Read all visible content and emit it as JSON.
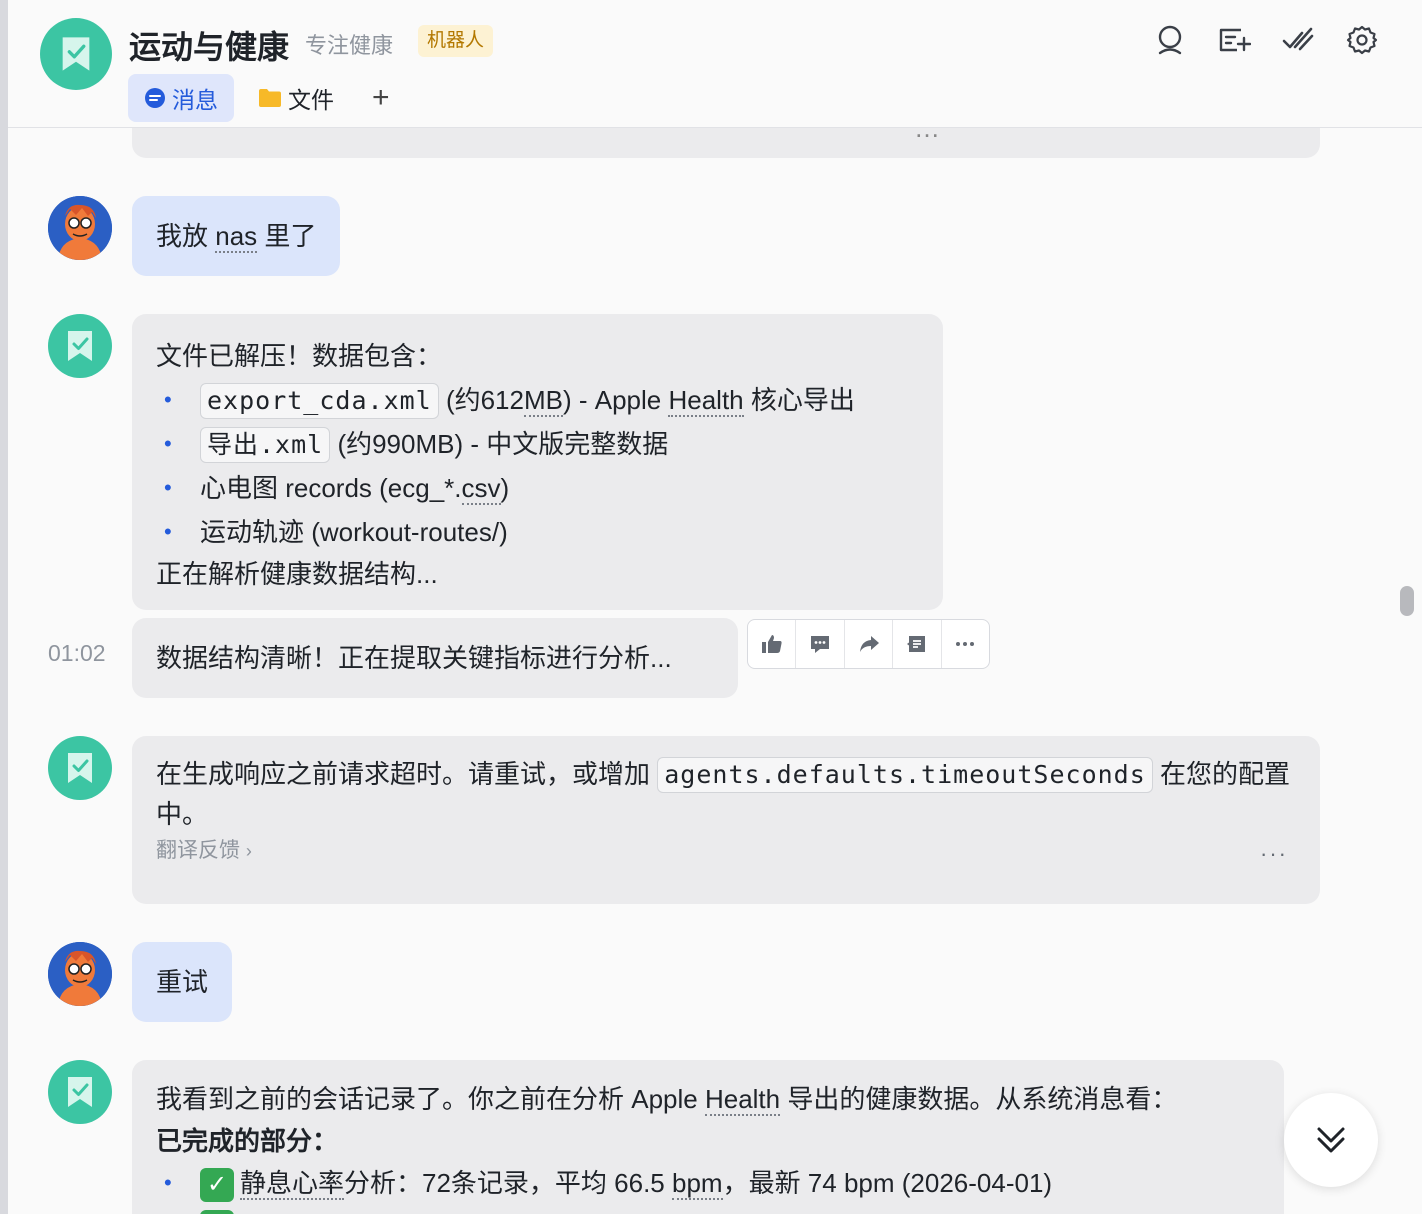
{
  "header": {
    "title": "运动与健康",
    "subtitle": "专注健康",
    "badge": "机器人",
    "tabs": [
      {
        "label": "消息",
        "active": true
      },
      {
        "label": "文件",
        "active": false
      }
    ],
    "add_tab": "+"
  },
  "messages": {
    "m0_partial": "…",
    "m1_user": {
      "pre": "我放 ",
      "link": "nas",
      "post": " 里了"
    },
    "m2_bot": {
      "intro": "文件已解压！数据包含：",
      "items": [
        {
          "code": "export_cda.xml",
          "pre": " (约612",
          "dotted": "MB",
          "mid": ") - Apple ",
          "dotted2": "Health",
          "post": " 核心导出"
        },
        {
          "code": "导出.xml",
          "text": " (约990MB) - 中文版完整数据"
        },
        {
          "pre": "心电图 records (ecg_*.",
          "dotted": "csv",
          "post": ")"
        },
        {
          "text": "运动轨迹 (workout-routes/)"
        }
      ],
      "outro": "正在解析健康数据结构..."
    },
    "m3_time": "01:02",
    "m3_bot": "数据结构清晰！正在提取关键指标进行分析...",
    "m4_bot": {
      "pre": "在生成响应之前请求超时。请重试，或增加 ",
      "code": "agents.defaults.timeoutSeconds",
      "post": " 在您的配置中。",
      "feedback": "翻译反馈",
      "more": "···"
    },
    "m5_user": "重试",
    "m6_bot": {
      "pre": "我看到之前的会话记录了。你之前在分析 Apple ",
      "dotted": "Health",
      "post": " 导出的健康数据。从系统消息看：",
      "bold": "已完成的部分：",
      "item1_check": "✓",
      "item1_pre": "静息心率",
      "item1_text": "分析：72条记录，平均 66.5 ",
      "item1_unit": "bpm",
      "item1_post": "，最新 74 bpm (2026-04-01)"
    }
  },
  "icons": [
    "search-icon",
    "add-message-icon",
    "check-all-icon",
    "settings-icon",
    "thumbs-up-icon",
    "comment-icon",
    "forward-icon",
    "quote-icon",
    "more-icon",
    "chevron-double-down-icon"
  ],
  "colors": {
    "accent": "#245bdb",
    "bot_avatar": "#3cc5a3",
    "user_bubble": "#dbe5fb",
    "bot_bubble": "#ebebed"
  }
}
